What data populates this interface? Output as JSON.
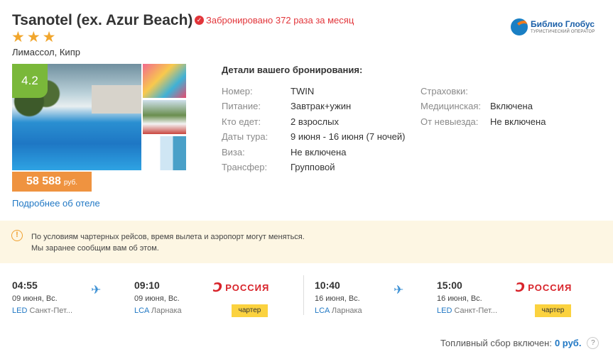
{
  "hotel": {
    "name": "Tsanotel (ex. Azur Beach)",
    "booked_text": "Забронировано 372 раза за месяц",
    "stars": 3,
    "location": "Лимассол, Кипр",
    "rating": "4.2",
    "price_value": "58 588",
    "price_currency": "руб.",
    "more_link": "Подробнее об отеле"
  },
  "operator": {
    "name": "Библио Глобус",
    "subtitle": "ТУРИСТИЧЕСКИЙ ОПЕРАТОР"
  },
  "details": {
    "title": "Детали вашего бронирования:",
    "rows": [
      {
        "label": "Номер:",
        "value": "TWIN"
      },
      {
        "label": "Питание:",
        "value": "Завтрак+ужин"
      },
      {
        "label": "Кто едет:",
        "value": "2 взрослых"
      },
      {
        "label": "Даты тура:",
        "value": "9 июня - 16 июня (7 ночей)"
      },
      {
        "label": "Виза:",
        "value": "Не включена"
      },
      {
        "label": "Трансфер:",
        "value": "Групповой"
      }
    ],
    "insurance": [
      {
        "label": "Страховки:",
        "value": ""
      },
      {
        "label": "Медицинская:",
        "value": "Включена"
      },
      {
        "label": "От невыезда:",
        "value": "Не включена"
      }
    ]
  },
  "notice": {
    "line1": "По условиям чартерных рейсов, время вылета и аэропорт могут меняться.",
    "line2": "Мы заранее сообщим вам об этом."
  },
  "flights": [
    {
      "dep_time": "04:55",
      "dep_date": "09 июня, Вс.",
      "dep_code": "LED",
      "dep_city": "Санкт-Пет...",
      "arr_time": "09:10",
      "arr_date": "09 июня, Вс.",
      "arr_code": "LCA",
      "arr_city": "Ларнака",
      "airline": "РОССИЯ",
      "type": "чартер"
    },
    {
      "dep_time": "10:40",
      "dep_date": "16 июня, Вс.",
      "dep_code": "LCA",
      "dep_city": "Ларнака",
      "arr_time": "15:00",
      "arr_date": "16 июня, Вс.",
      "arr_code": "LED",
      "arr_city": "Санкт-Пет...",
      "airline": "РОССИЯ",
      "type": "чартер"
    }
  ],
  "fuel": {
    "label": "Топливный сбор включен:",
    "value": "0 руб.",
    "help": "?"
  },
  "colors": {
    "rating_green": "#7ab83a",
    "price_orange": "#ef9340",
    "link_blue": "#1f77c4",
    "alert_red": "#e2353a",
    "charter_yellow": "#fbd23f",
    "notice_bg": "#fdf6e3"
  },
  "icons": {
    "booked": "check-circle-icon",
    "star": "star-icon",
    "notice": "warning-circle-icon",
    "plane": "airplane-icon",
    "airline": "rossiya-logo-icon",
    "help": "question-icon"
  }
}
